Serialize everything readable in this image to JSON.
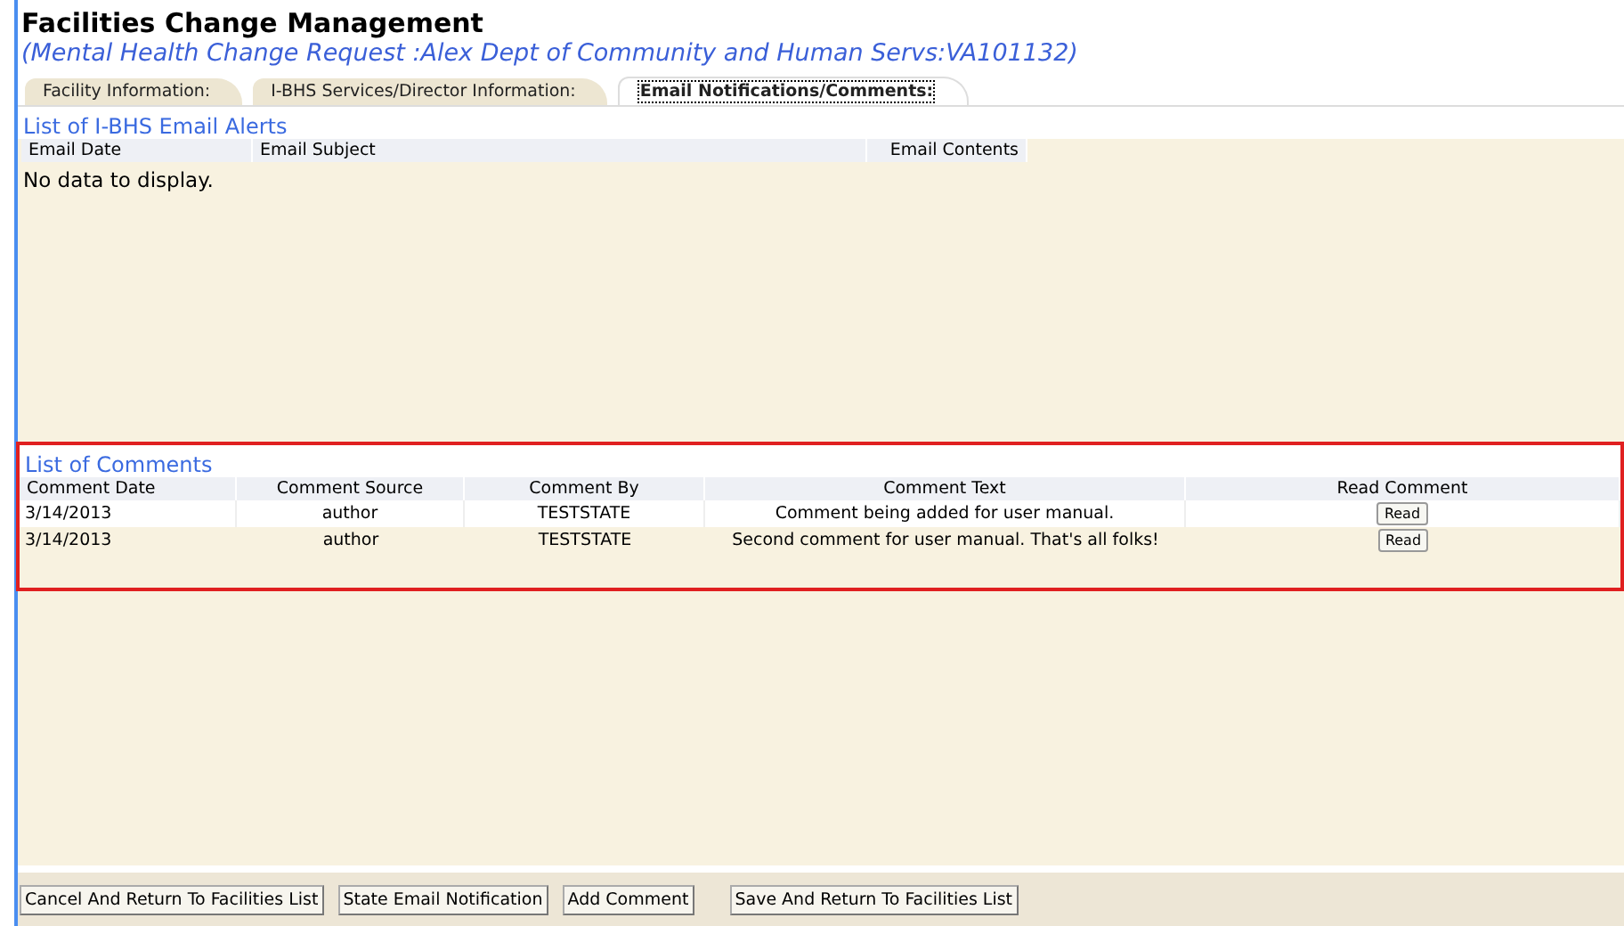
{
  "title": "Facilities Change Management",
  "subtitle": "(Mental Health Change Request :Alex Dept of Community and Human Servs:VA101132)",
  "tabs": [
    {
      "label": "Facility Information:",
      "selected": false
    },
    {
      "label": "I-BHS Services/Director Information:",
      "selected": false
    },
    {
      "label": "Email Notifications/Comments:",
      "selected": true
    }
  ],
  "email_alerts": {
    "heading": "List of I-BHS Email Alerts",
    "columns": [
      "Email Date",
      "Email Subject",
      "Email Contents"
    ],
    "empty_text": "No data to display."
  },
  "comments": {
    "heading": "List of Comments",
    "columns": [
      "Comment Date",
      "Comment Source",
      "Comment By",
      "Comment Text",
      "Read Comment"
    ],
    "rows": [
      {
        "date": "3/14/2013",
        "source": "author",
        "by": "TESTSTATE",
        "text": "Comment being added for user manual.",
        "action": "Read"
      },
      {
        "date": "3/14/2013",
        "source": "author",
        "by": "TESTSTATE",
        "text": "Second comment for user manual. That's all folks!",
        "action": "Read"
      }
    ]
  },
  "buttons": [
    "Cancel And Return To Facilities List",
    "State Email Notification",
    "Add Comment",
    "Save And Return To Facilities List"
  ]
}
